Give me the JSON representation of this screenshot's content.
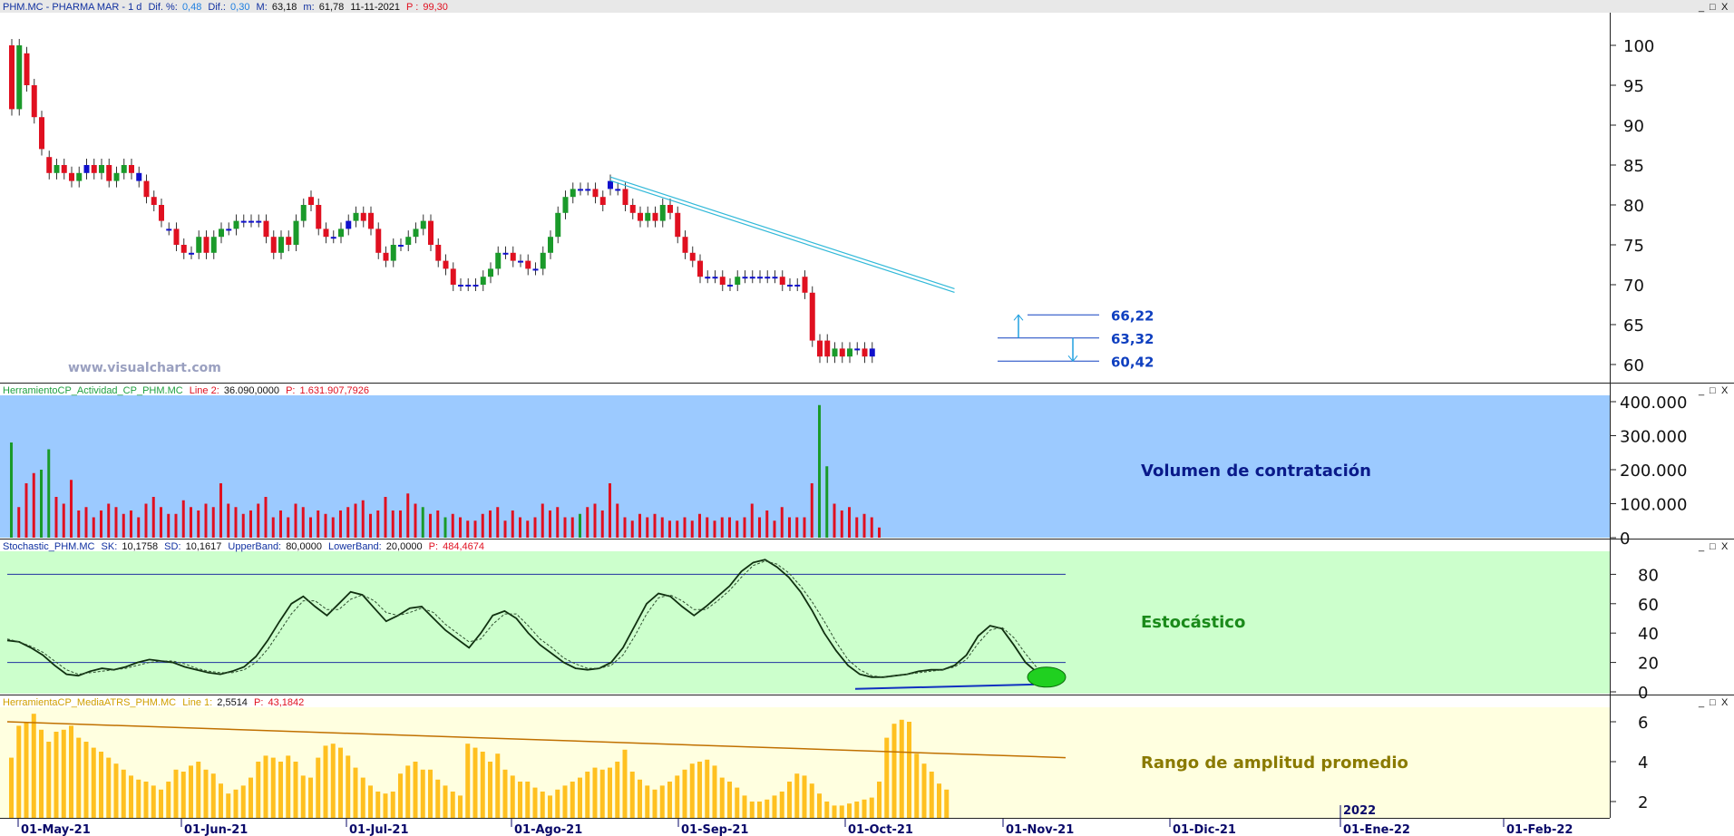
{
  "header": {
    "symbol": "PHM.MC - PHARMA MAR -  1 d",
    "dif_pct_label": "Dif. %:",
    "dif_pct": "0,48",
    "dif_label": "Dif.:",
    "dif": "0,30",
    "max_label": "M:",
    "max": "63,18",
    "min_label": "m:",
    "min": "61,78",
    "date": "11-11-2021",
    "p_label": "P :",
    "p": "99,30"
  },
  "watermark": "www.visualchart.com",
  "panels": {
    "volume": {
      "name": "HerramientoCP_Actividad_CP_PHM.MC",
      "l2_label": "Line 2:",
      "l2": "36.090,0000",
      "p_label": "P:",
      "p": "1.631.907,7926",
      "title": "Volumen de contratación"
    },
    "stoch": {
      "name": "Stochastic_PHM.MC",
      "sk_label": "SK:",
      "sk": "10,1758",
      "sd_label": "SD:",
      "sd": "10,1617",
      "ub_label": "UpperBand:",
      "ub": "80,0000",
      "lb_label": "LowerBand:",
      "lb": "20,0000",
      "p_label": "P:",
      "p": "484,4674",
      "title": "Estocástico"
    },
    "atr": {
      "name": "HerramientaCP_MediaATRS_PHM.MC",
      "l1_label": "Line 1:",
      "l1": "2,5514",
      "p_label": "P:",
      "p": "43,1842",
      "title": "Rango de amplitud promedio"
    }
  },
  "levels": [
    "66,22",
    "63,32",
    "60,42"
  ],
  "window_controls": [
    "_",
    "□",
    "X"
  ],
  "colors": {
    "up": "#1a9a2a",
    "down": "#e01020",
    "neutral": "#1010cc",
    "volume_bg": "#9ccaff",
    "stoch_bg": "#ccffcc",
    "atr_bg": "#ffffe0",
    "atr_bar": "#ffc020",
    "atr_line": "#c07000",
    "trend": "#30b8d8"
  },
  "chart_data": [
    {
      "type": "candlestick",
      "title": "PHM.MC - PHARMA MAR",
      "ylim": [
        58,
        104
      ],
      "y_ticks": [
        "100",
        "95",
        "90",
        "85",
        "80",
        "75",
        "70",
        "65",
        "60"
      ],
      "x_ticks": [
        "01-May-21",
        "01-Jun-21",
        "01-Jul-21",
        "01-Ago-21",
        "01-Sep-21",
        "01-Oct-21",
        "01-Nov-21",
        "01-Dic-21",
        "01-Ene-22",
        "01-Feb-22"
      ],
      "year_marker": "2022",
      "close": [
        92,
        100,
        95,
        91,
        87,
        84,
        85,
        84,
        83,
        84,
        85,
        84,
        85,
        83,
        84,
        85,
        84,
        83,
        81,
        80,
        78,
        77,
        75,
        74,
        74,
        76,
        74,
        76,
        77,
        77,
        78,
        78,
        78,
        78,
        76,
        74,
        76,
        75,
        78,
        80,
        80,
        77,
        76,
        76,
        77,
        78,
        79,
        78,
        77,
        74,
        73,
        75,
        75,
        76,
        77,
        78,
        75,
        73,
        72,
        70,
        70,
        70,
        70,
        71,
        72,
        74,
        74,
        73,
        73,
        72,
        72,
        74,
        76,
        79,
        81,
        82,
        82,
        82,
        81,
        80,
        82,
        82,
        80,
        79,
        78,
        79,
        78,
        80,
        79,
        76,
        74,
        73,
        71,
        71,
        71,
        70,
        70,
        71,
        71,
        71,
        71,
        71,
        71,
        70,
        70,
        70,
        69,
        63,
        61,
        61,
        62,
        61,
        62,
        62,
        61,
        62
      ],
      "open": [
        100,
        92,
        99,
        95,
        91,
        86,
        84,
        85,
        84,
        83,
        84,
        85,
        84,
        85,
        83,
        84,
        85,
        84,
        83,
        81,
        80,
        77,
        77,
        75,
        74,
        74,
        76,
        74,
        76,
        77,
        77,
        78,
        78,
        78,
        78,
        76,
        74,
        76,
        75,
        78,
        81,
        80,
        77,
        76,
        76,
        77,
        78,
        79,
        79,
        77,
        74,
        73,
        75,
        75,
        76,
        77,
        78,
        75,
        73,
        72,
        70,
        70,
        70,
        70,
        71,
        72,
        74,
        74,
        73,
        73,
        72,
        72,
        74,
        76,
        79,
        81,
        82,
        82,
        82,
        81,
        83,
        82,
        82,
        80,
        79,
        78,
        79,
        78,
        80,
        79,
        76,
        74,
        73,
        71,
        71,
        71,
        70,
        70,
        71,
        71,
        71,
        71,
        71,
        71,
        70,
        70,
        71,
        69,
        63,
        63,
        61,
        62,
        61,
        62,
        62,
        61
      ],
      "levels": [
        66.22,
        63.32,
        60.42
      ],
      "trendline": {
        "from_index": 80,
        "from_value": 83.5,
        "to_index": 126,
        "to_value": 69.5
      }
    },
    {
      "type": "bar",
      "title": "Volumen de contratación",
      "ylim": [
        0,
        400000
      ],
      "y_ticks": [
        "400.000",
        "300.000",
        "200.000",
        "100.000",
        "0"
      ],
      "values": [
        280,
        90,
        160,
        190,
        200,
        260,
        120,
        100,
        170,
        80,
        90,
        60,
        80,
        100,
        90,
        70,
        80,
        60,
        100,
        120,
        90,
        70,
        70,
        110,
        90,
        80,
        100,
        90,
        160,
        100,
        90,
        70,
        80,
        100,
        120,
        60,
        80,
        60,
        100,
        90,
        60,
        80,
        70,
        60,
        80,
        90,
        100,
        110,
        70,
        80,
        120,
        80,
        80,
        130,
        100,
        90,
        70,
        80,
        60,
        70,
        60,
        50,
        50,
        70,
        80,
        90,
        50,
        80,
        60,
        50,
        60,
        100,
        80,
        90,
        60,
        60,
        70,
        90,
        100,
        80,
        160,
        100,
        60,
        50,
        70,
        60,
        70,
        60,
        50,
        50,
        60,
        50,
        70,
        60,
        50,
        60,
        60,
        50,
        60,
        100,
        60,
        80,
        50,
        90,
        60,
        60,
        60,
        160,
        390,
        210,
        100,
        80,
        90,
        60,
        70,
        60,
        30
      ],
      "colors_by_index": "green where price rose strongly, red otherwise"
    },
    {
      "type": "line",
      "title": "Estocástico",
      "ylim": [
        0,
        90
      ],
      "y_ticks": [
        "80",
        "60",
        "40",
        "20",
        "0"
      ],
      "bands": [
        80,
        20
      ],
      "series": [
        {
          "name": "SK",
          "values": [
            35,
            34,
            30,
            25,
            18,
            12,
            11,
            14,
            16,
            15,
            17,
            20,
            22,
            21,
            20,
            17,
            15,
            13,
            12,
            14,
            17,
            24,
            35,
            48,
            60,
            65,
            58,
            52,
            60,
            68,
            66,
            57,
            48,
            52,
            57,
            58,
            50,
            42,
            36,
            30,
            40,
            52,
            55,
            50,
            40,
            32,
            26,
            20,
            16,
            15,
            16,
            20,
            30,
            45,
            60,
            67,
            65,
            58,
            52,
            58,
            65,
            72,
            82,
            88,
            90,
            85,
            78,
            68,
            55,
            40,
            28,
            18,
            12,
            10,
            10,
            11,
            12,
            14,
            15,
            15,
            18,
            25,
            38,
            45,
            43,
            32,
            20,
            13,
            10,
            10
          ]
        },
        {
          "name": "SD",
          "values": [
            36,
            34,
            31,
            27,
            21,
            15,
            12,
            13,
            14,
            15,
            16,
            18,
            20,
            21,
            21,
            19,
            16,
            14,
            13,
            13,
            15,
            20,
            29,
            41,
            53,
            62,
            62,
            56,
            56,
            63,
            66,
            62,
            54,
            52,
            54,
            57,
            54,
            46,
            40,
            34,
            36,
            46,
            53,
            53,
            45,
            36,
            30,
            23,
            19,
            16,
            16,
            18,
            25,
            38,
            53,
            64,
            66,
            62,
            56,
            56,
            62,
            69,
            78,
            86,
            89,
            87,
            81,
            72,
            61,
            48,
            34,
            22,
            15,
            11,
            10,
            11,
            12,
            13,
            14,
            15,
            17,
            22,
            33,
            42,
            44,
            37,
            26,
            16,
            12,
            10
          ]
        }
      ]
    },
    {
      "type": "bar",
      "title": "Rango de amplitud promedio",
      "ylim": [
        1,
        7
      ],
      "y_ticks": [
        "6",
        "4",
        "2"
      ],
      "values": [
        4.2,
        5.8,
        6.0,
        6.4,
        5.6,
        5.0,
        5.5,
        5.6,
        5.8,
        5.2,
        5.0,
        4.7,
        4.5,
        4.2,
        3.9,
        3.6,
        3.3,
        3.1,
        3.0,
        2.8,
        2.6,
        3.0,
        3.6,
        3.5,
        3.8,
        4.0,
        3.6,
        3.4,
        2.9,
        2.4,
        2.6,
        2.8,
        3.2,
        4.0,
        4.3,
        4.2,
        4.0,
        4.3,
        4.0,
        3.3,
        3.2,
        4.2,
        4.8,
        4.9,
        4.7,
        4.3,
        3.7,
        3.2,
        2.8,
        2.5,
        2.4,
        2.5,
        3.4,
        3.8,
        4.0,
        3.6,
        3.6,
        3.1,
        2.8,
        2.5,
        2.3,
        4.9,
        4.7,
        4.5,
        4.0,
        4.4,
        3.6,
        3.3,
        3.0,
        3.0,
        2.7,
        2.5,
        2.3,
        2.6,
        2.8,
        3.0,
        3.2,
        3.5,
        3.7,
        3.6,
        3.7,
        4.0,
        4.6,
        3.5,
        3.1,
        2.8,
        2.6,
        2.8,
        3.0,
        3.3,
        3.6,
        3.9,
        4.0,
        4.1,
        3.8,
        3.2,
        3.0,
        2.7,
        2.3,
        2.0,
        2.0,
        2.1,
        2.3,
        2.5,
        3.0,
        3.4,
        3.3,
        2.9,
        2.4,
        2.0,
        1.8,
        1.8,
        1.9,
        2.0,
        2.1,
        2.2,
        3.0,
        5.2,
        5.9,
        6.1,
        6.0,
        4.4,
        3.9,
        3.5,
        2.9,
        2.6
      ],
      "series_line": {
        "name": "Line 1",
        "from": 6.0,
        "to": 4.2
      }
    }
  ]
}
